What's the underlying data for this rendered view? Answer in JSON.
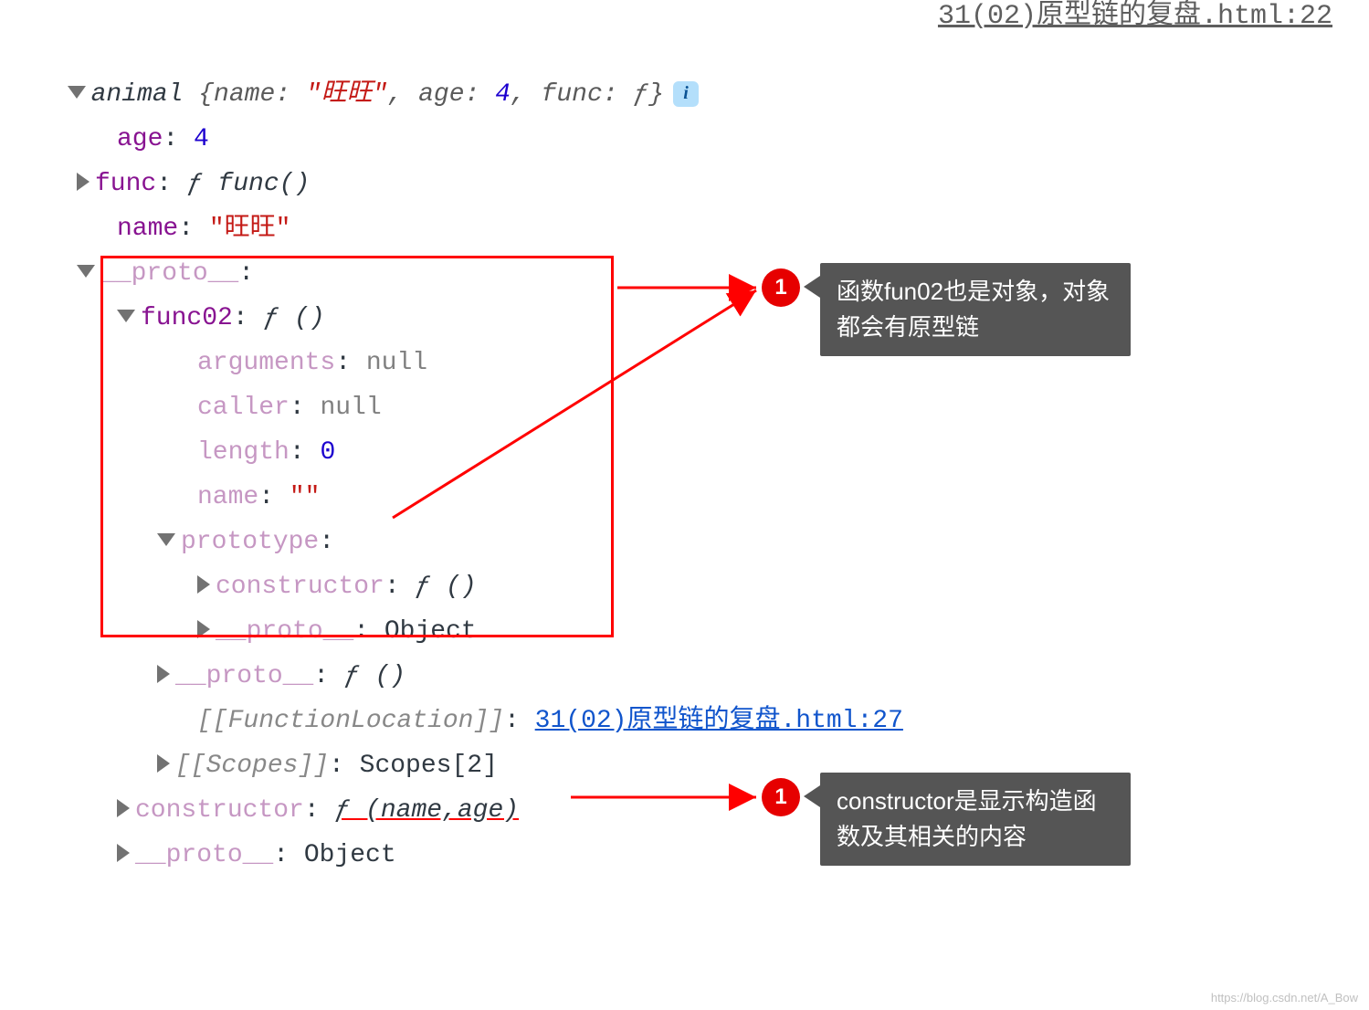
{
  "top_ref": "31(02)原型链的复盘.html:22",
  "summary": {
    "class": "animal",
    "name_key": "name",
    "name_val": "\"旺旺\"",
    "age_key": "age",
    "age_val": "4",
    "func_key": "func",
    "func_val": "ƒ"
  },
  "props": {
    "age_key": "age",
    "age_val": "4",
    "func_key": "func",
    "func_val": "ƒ func()",
    "name_key": "name",
    "name_val": "\"旺旺\"",
    "proto_key": "__proto__"
  },
  "func02": {
    "key": "func02",
    "val": "ƒ ()",
    "arguments_key": "arguments",
    "arguments_val": "null",
    "caller_key": "caller",
    "caller_val": "null",
    "length_key": "length",
    "length_val": "0",
    "name_key": "name",
    "name_val": "\"\"",
    "prototype_key": "prototype",
    "constructor_key": "constructor",
    "constructor_val": "ƒ ()",
    "proto_key": "__proto__",
    "proto_val": "Object",
    "outer_proto_key": "__proto__",
    "outer_proto_val": "ƒ ()",
    "funcloc_key": "[[FunctionLocation]]",
    "funcloc_val": "31(02)原型链的复盘.html:27",
    "scopes_key": "[[Scopes]]",
    "scopes_val": "Scopes[2]"
  },
  "outer": {
    "constructor_key": "constructor",
    "constructor_val": "ƒ (name,age)",
    "proto_key": "__proto__",
    "proto_val": "Object"
  },
  "callouts": {
    "c1": "函数fun02也是对象，对象都会有原型链",
    "c2": "constructor是显示构造函数及其相关的内容",
    "badge1": "1",
    "badge2": "1"
  },
  "watermark": "https://blog.csdn.net/A_Bow"
}
